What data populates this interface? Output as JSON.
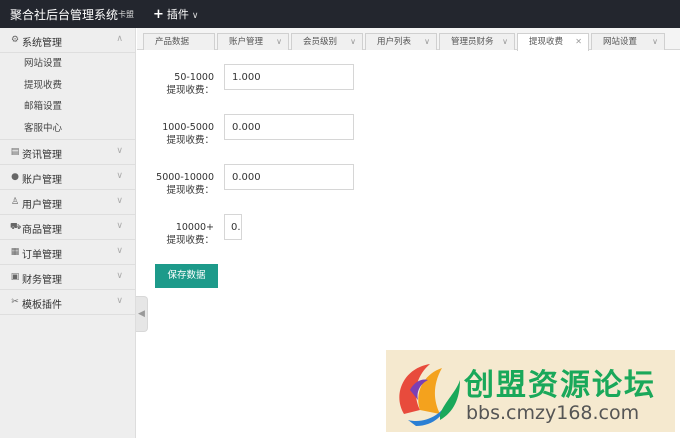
{
  "header": {
    "title": "聚合社后台管理系统",
    "subtitle": "卡盟",
    "plugin_label": "插件"
  },
  "sidebar": {
    "groups": [
      {
        "label": "系统管理",
        "icon": "gear-icon",
        "expanded": true,
        "items": [
          "网站设置",
          "提现收费",
          "邮箱设置",
          "客服中心"
        ]
      },
      {
        "label": "资讯管理",
        "icon": "news-icon"
      },
      {
        "label": "账户管理",
        "icon": "user-icon"
      },
      {
        "label": "用户管理",
        "icon": "users-icon"
      },
      {
        "label": "商品管理",
        "icon": "cart-icon"
      },
      {
        "label": "订单管理",
        "icon": "calendar-icon"
      },
      {
        "label": "财务管理",
        "icon": "finance-icon"
      },
      {
        "label": "模板插件",
        "icon": "tools-icon"
      }
    ]
  },
  "tabs": [
    {
      "label": "产品数据"
    },
    {
      "label": "账户管理"
    },
    {
      "label": "会员级别"
    },
    {
      "label": "用户列表"
    },
    {
      "label": "管理员财务"
    },
    {
      "label": "提现收费",
      "active": true
    },
    {
      "label": "网站设置"
    }
  ],
  "form": {
    "rows": [
      {
        "range": "50-1000",
        "suffix": "提现收费：",
        "value": "1.000"
      },
      {
        "range": "1000-5000",
        "suffix": "提现收费：",
        "value": "0.000"
      },
      {
        "range": "5000-10000",
        "suffix": "提现收费：",
        "value": "0.000"
      },
      {
        "range": "10000+",
        "suffix": "提现收费：",
        "value": "0."
      }
    ],
    "save_label": "保存数据"
  },
  "watermark": {
    "name": "创盟资源论坛",
    "url": "bbs.cmzy168.com"
  },
  "colors": {
    "topbar": "#23262e",
    "sidebar": "#eeeeee",
    "primary_button": "#1d9a8a",
    "watermark_bg": "#f5e9cf",
    "watermark_text": "#1aa85a"
  }
}
